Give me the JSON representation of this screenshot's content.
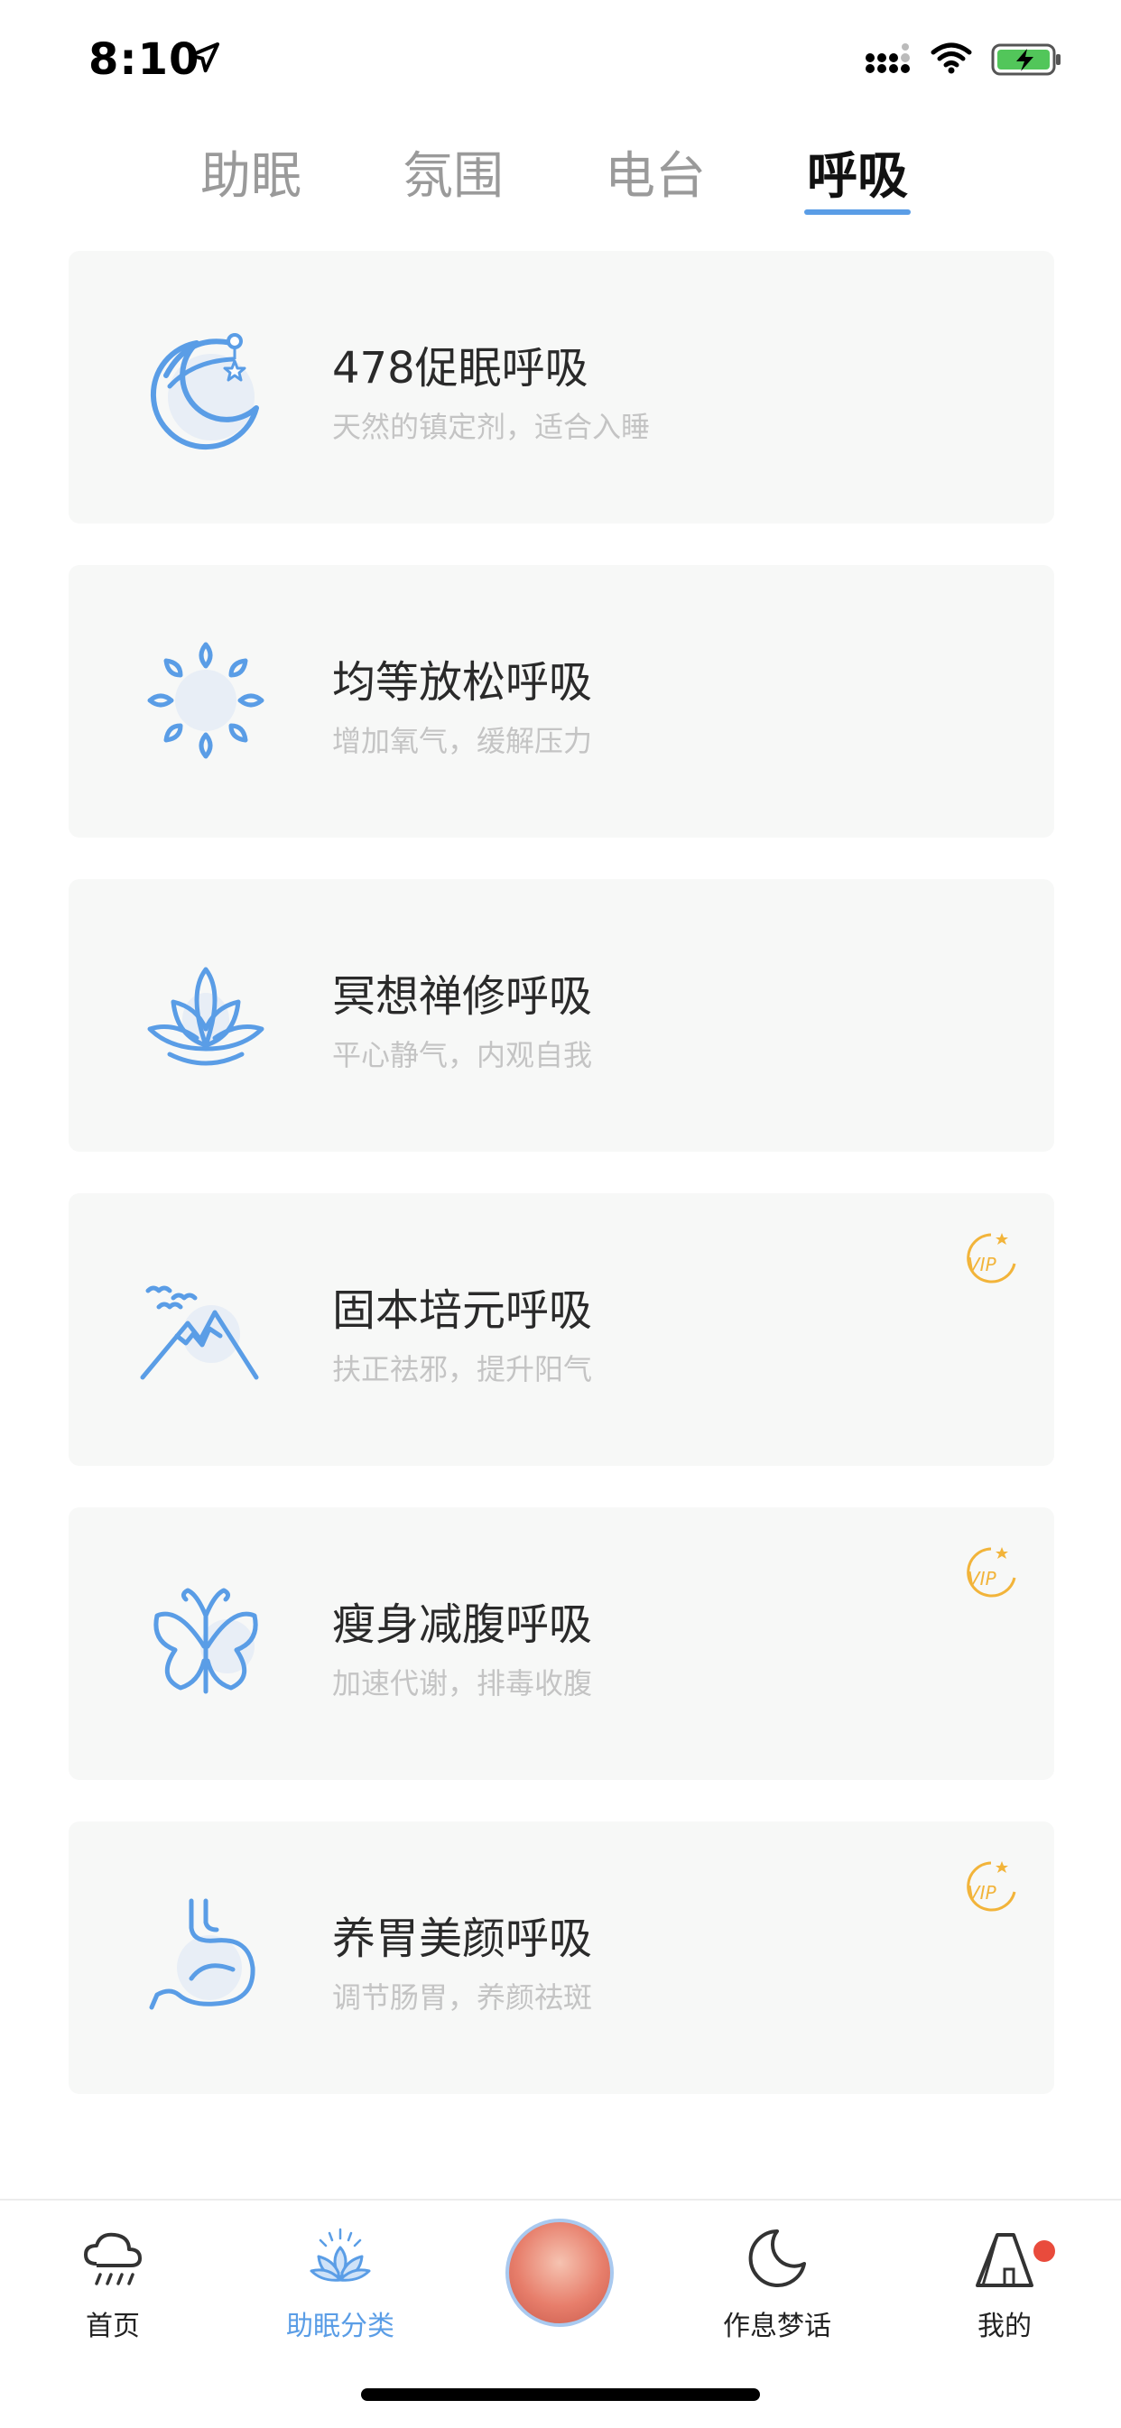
{
  "status_bar": {
    "time": "8:10"
  },
  "tabs": [
    {
      "label": "助眠",
      "active": false
    },
    {
      "label": "氛围",
      "active": false
    },
    {
      "label": "电台",
      "active": false
    },
    {
      "label": "呼吸",
      "active": true
    }
  ],
  "cards": [
    {
      "title": "478促眠呼吸",
      "subtitle": "天然的镇定剂，适合入睡",
      "icon": "moon-sleep-icon",
      "vip": false
    },
    {
      "title": "均等放松呼吸",
      "subtitle": "增加氧气，缓解压力",
      "icon": "sun-leaves-icon",
      "vip": false
    },
    {
      "title": "冥想禅修呼吸",
      "subtitle": "平心静气，内观自我",
      "icon": "lotus-icon",
      "vip": false
    },
    {
      "title": "固本培元呼吸",
      "subtitle": "扶正祛邪，提升阳气",
      "icon": "mountain-icon",
      "vip": true
    },
    {
      "title": "瘦身减腹呼吸",
      "subtitle": "加速代谢，排毒收腹",
      "icon": "butterfly-icon",
      "vip": true
    },
    {
      "title": "养胃美颜呼吸",
      "subtitle": "调节肠胃，养颜祛斑",
      "icon": "stomach-icon",
      "vip": true
    }
  ],
  "vip_label": "VIP",
  "bottom_nav": [
    {
      "label": "首页",
      "icon": "cloud-rain-icon",
      "active": false
    },
    {
      "label": "助眠分类",
      "icon": "lotus-nav-icon",
      "active": true
    },
    {
      "label": "",
      "icon": "player-orb",
      "active": false
    },
    {
      "label": "作息梦话",
      "icon": "moon-nav-icon",
      "active": false
    },
    {
      "label": "我的",
      "icon": "tent-icon",
      "active": false
    }
  ],
  "colors": {
    "accent": "#5a9de6",
    "vip": "#f2b43a",
    "card_bg": "#f7f8f7",
    "badge": "#e94b3c"
  }
}
